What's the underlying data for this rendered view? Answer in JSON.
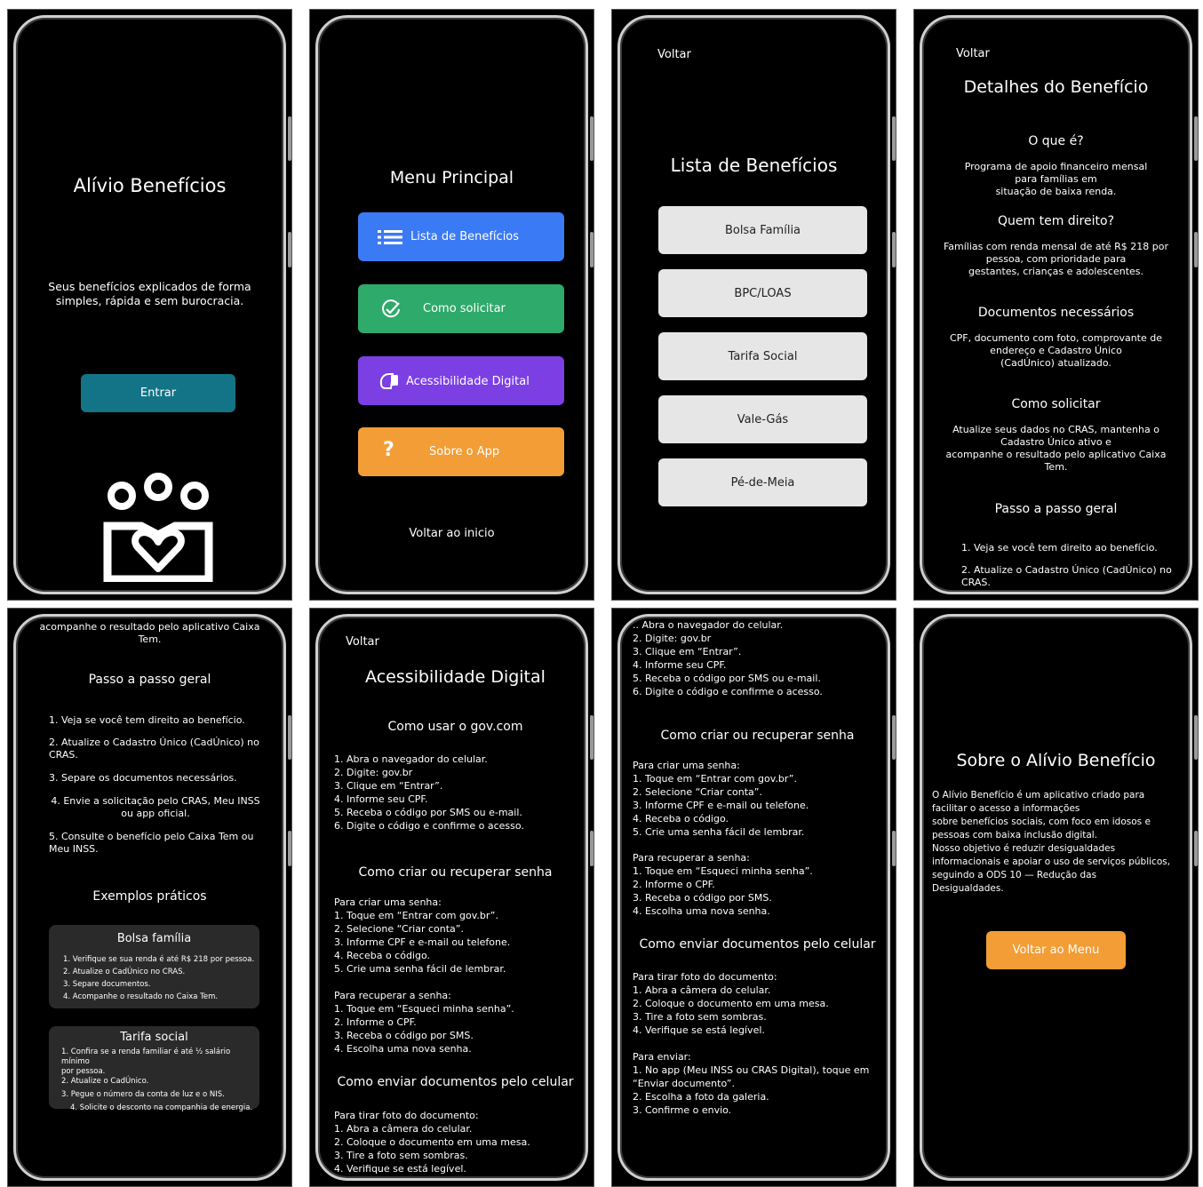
{
  "screen1": {
    "title": "Alívio Benefícios",
    "subtitle_line1": "Seus benefícios explicados de forma",
    "subtitle_line2": "simples, rápida e sem burocracia.",
    "enter_button": "Entrar",
    "enter_color": "#127486",
    "logo_icon": "family-heart-icon"
  },
  "screen2": {
    "title": "Menu Principal",
    "buttons": [
      {
        "label": "Lista de Benefícios",
        "icon": "list-icon",
        "color": "#3b7af5"
      },
      {
        "label": "Como solicitar",
        "icon": "check-circle-icon",
        "color": "#2eaa6a"
      },
      {
        "label": "Acessibilidade Digital",
        "icon": "accessibility-icon",
        "color": "#7b3fe4"
      },
      {
        "label": "Sobre o App",
        "icon": "question-icon",
        "color": "#f29d36"
      }
    ],
    "back_home": "Voltar ao inicio"
  },
  "screen3": {
    "back": "Voltar",
    "title": "Lista de Benefícios",
    "items": [
      "Bolsa Família",
      "BPC/LOAS",
      "Tarifa Social",
      "Vale-Gás",
      "Pé-de-Meia"
    ]
  },
  "screen4": {
    "back": "Voltar",
    "title": "Detalhes do Benefício",
    "what_heading": "O que é?",
    "what_lines": [
      "Programa de apoio financeiro mensal",
      "para famílias em",
      "situação de baixa renda."
    ],
    "who_heading": "Quem tem direito?",
    "who_lines": [
      "Famílias com renda mensal de até R$ 218 por",
      "pessoa, com prioridade para",
      "gestantes, crianças e adolescentes."
    ],
    "docs_heading": "Documentos necessários",
    "docs_lines": [
      "CPF, documento com foto, comprovante de",
      "endereço e Cadastro Único",
      "(CadÚnico) atualizado."
    ],
    "how_heading": "Como solicitar",
    "how_lines": [
      "Atualize seus dados no CRAS, mantenha o",
      "Cadastro Único ativo e",
      "acompanhe o resultado pelo aplicativo Caixa",
      "Tem."
    ],
    "steps_heading": "Passo a passo geral",
    "step1": "1. Veja se você tem direito ao benefício.",
    "step2_lines": [
      "2. Atualize o Cadastro Único (CadÚnico) no",
      "CRAS."
    ]
  },
  "screen5": {
    "top_lines": [
      "acompanhe o resultado pelo aplicativo Caixa",
      "Tem."
    ],
    "steps_heading": "Passo a passo geral",
    "step1": "1. Veja se você tem direito ao benefício.",
    "step2_lines": [
      "2. Atualize o Cadastro Único (CadÚnico) no",
      "CRAS."
    ],
    "step3": "3. Separe os documentos necessários.",
    "step4_lines": [
      "4. Envie a solicitação pelo CRAS, Meu INSS",
      "ou app oficial."
    ],
    "step5_lines": [
      "5. Consulte o benefício pelo Caixa Tem ou",
      "Meu INSS."
    ],
    "examples_heading": "Exemplos práticos",
    "card1_title": "Bolsa família",
    "card1_lines": [
      "1. Verifique se sua renda é até R$ 218 por pessoa.",
      "2. Atualize o CadÚnico no CRAS.",
      "3. Separe documentos.",
      "4. Acompanhe o resultado no Caixa Tem."
    ],
    "card2_title": "Tarifa social",
    "card2_lines": [
      "1. Confira se a renda familiar é até ½ salário mínimo",
      "por pessoa.",
      "2. Atualize o CadÚnico.",
      "3. Pegue o número da conta de luz e o NIS.",
      "4. Solicite o desconto na companhia de energia."
    ]
  },
  "screen6": {
    "back": "Voltar",
    "title": "Acessibilidade Digital",
    "gov_heading": "Como usar o gov.com",
    "gov_lines": [
      "1. Abra o navegador do celular.",
      "2. Digite: gov.br",
      "3. Clique em “Entrar”.",
      "4. Informe seu CPF.",
      "5. Receba o código por SMS ou e-mail.",
      "6. Digite o código e confirme o acesso."
    ],
    "pwd_heading": "Como criar ou recuperar senha",
    "create_lines": [
      "Para criar uma senha:",
      "1. Toque em “Entrar com gov.br”.",
      "2. Selecione “Criar conta”.",
      "3. Informe CPF e e-mail ou telefone.",
      "4. Receba o código.",
      "5. Crie uma senha fácil de lembrar."
    ],
    "recover_lines": [
      "Para recuperar a senha:",
      "1. Toque em “Esqueci minha senha”.",
      "2. Informe o CPF.",
      "3. Receba o código por SMS.",
      "4. Escolha uma nova senha."
    ],
    "send_heading": "Como enviar documentos pelo celular",
    "photo_lines": [
      "Para tirar foto do documento:",
      "1. Abra a câmera do celular.",
      "2. Coloque o documento em uma mesa.",
      "3. Tire a foto sem sombras.",
      "4. Verifique se está legível."
    ]
  },
  "screen7": {
    "top_lines": [
      ".. Abra o navegador do celular.",
      "2. Digite: gov.br",
      "3. Clique em “Entrar”.",
      "4. Informe seu CPF.",
      "5. Receba o código por SMS ou e-mail.",
      "6. Digite o código e confirme o acesso."
    ],
    "pwd_heading": "Como criar ou recuperar senha",
    "create_lines": [
      "Para criar uma senha:",
      "1. Toque em “Entrar com gov.br”.",
      "2. Selecione “Criar conta”.",
      "3. Informe CPF e e-mail ou telefone.",
      "4. Receba o código.",
      "5. Crie uma senha fácil de lembrar."
    ],
    "recover_lines": [
      "Para recuperar a senha:",
      "1. Toque em “Esqueci minha senha”.",
      "2. Informe o CPF.",
      "3. Receba o código por SMS.",
      "4. Escolha uma nova senha."
    ],
    "send_heading": "Como enviar documentos pelo celular",
    "photo_lines": [
      "Para tirar foto do documento:",
      "1. Abra a câmera do celular.",
      "2. Coloque o documento em uma mesa.",
      "3. Tire a foto sem sombras.",
      "4. Verifique se está legível."
    ],
    "send_lines": [
      "Para enviar:",
      "1. No app (Meu INSS ou CRAS Digital), toque em",
      "“Enviar documento”.",
      "2. Escolha a foto da galeria.",
      "3. Confirme o envio."
    ]
  },
  "screen8": {
    "title": "Sobre o Alívio Benefício",
    "about_lines": [
      "O Alívio Benefício é um aplicativo criado para",
      "facilitar o acesso a informações",
      "sobre benefícios sociais, com foco em idosos e",
      "pessoas com baixa inclusão digital.",
      "Nosso objetivo é reduzir desigualdades",
      "informacionais e apoiar o uso de serviços públicos,",
      "seguindo a ODS 10 — Redução das",
      "Desigualdades."
    ],
    "back_menu": "Voltar ao Menu",
    "back_menu_color": "#f29d36"
  }
}
